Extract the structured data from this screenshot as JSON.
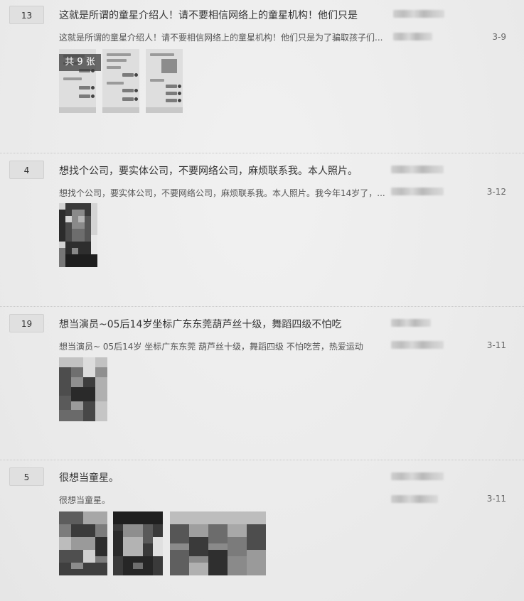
{
  "posts": [
    {
      "reply_count": "13",
      "title": "这就是所谓的童星介绍人！请不要相信网络上的童星机构！他们只是",
      "excerpt": "这就是所谓的童星介绍人！请不要相信网络上的童星机构！他们只是为了骗取孩子们...",
      "date": "3-9",
      "image_count_label": "共 9 张"
    },
    {
      "reply_count": "4",
      "title": "想找个公司，要实体公司，不要网络公司，麻烦联系我。本人照片。",
      "excerpt": "想找个公司，要实体公司，不要网络公司，麻烦联系我。本人照片。我今年14岁了，...",
      "date": "3-12"
    },
    {
      "reply_count": "19",
      "title": "想当演员~05后14岁坐标广东东莞葫芦丝十级，舞蹈四级不怕吃",
      "excerpt": "想当演员~ 05后14岁 坐标广东东莞 葫芦丝十级，舞蹈四级 不怕吃苦，热爱运动",
      "date": "3-11"
    },
    {
      "reply_count": "5",
      "title": "很想当童星。",
      "excerpt": "很想当童星。",
      "date": "3-11"
    }
  ]
}
